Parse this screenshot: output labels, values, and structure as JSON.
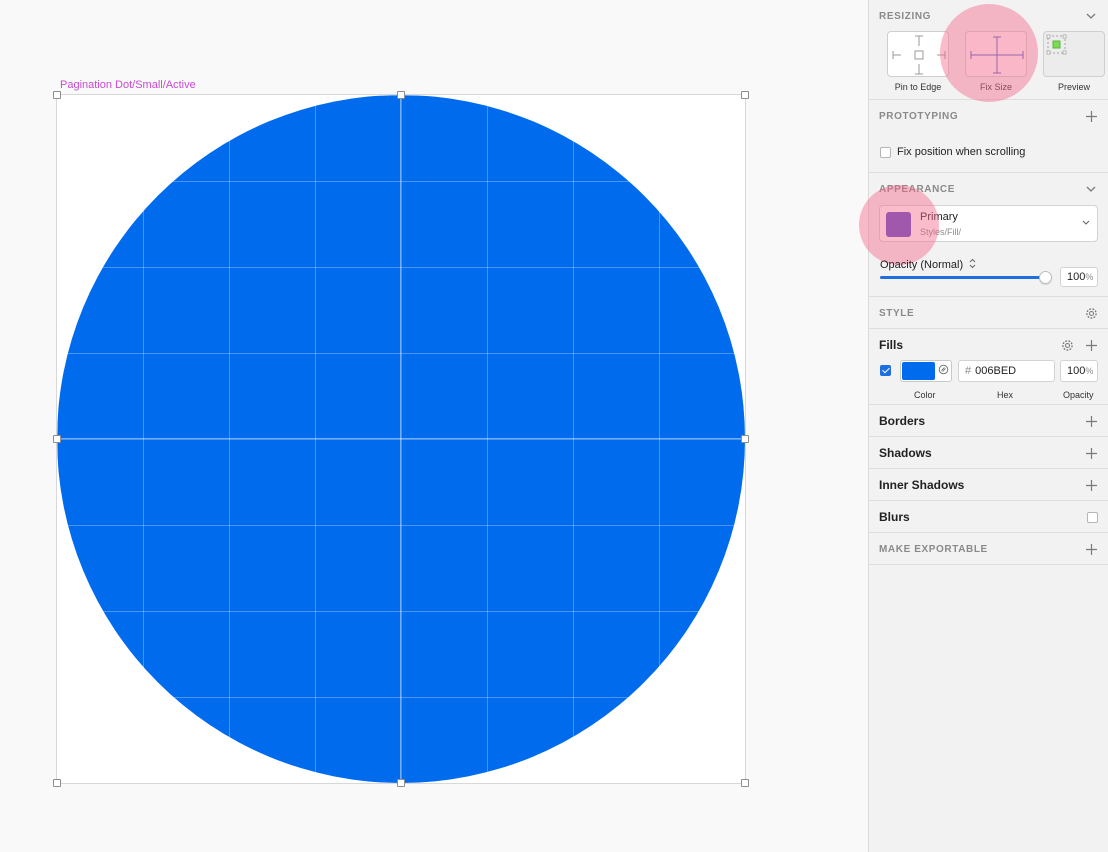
{
  "canvas": {
    "artboard_label": "Pagination Dot/Small/Active",
    "dot_color": "#006BED"
  },
  "inspector": {
    "resizing": {
      "title": "RESIZING",
      "options": [
        {
          "label": "Pin to Edge"
        },
        {
          "label": "Fix Size"
        },
        {
          "label": "Preview"
        }
      ]
    },
    "prototyping": {
      "title": "PROTOTYPING",
      "fix_position_label": "Fix position when scrolling"
    },
    "appearance": {
      "title": "APPEARANCE",
      "style_name": "Primary",
      "style_path": "Styles/Fill/",
      "swatch_color": "#5a4bc5",
      "opacity_label": "Opacity (Normal)",
      "opacity_value": "100",
      "opacity_unit": "%",
      "opacity_fraction": 1.0
    },
    "style": {
      "title": "STYLE"
    },
    "fills": {
      "title": "Fills",
      "enabled": true,
      "hex_prefix": "#",
      "hex": "006BED",
      "opacity_value": "100",
      "opacity_unit": "%",
      "captions": {
        "color": "Color",
        "hex": "Hex",
        "opacity": "Opacity"
      }
    },
    "borders": {
      "title": "Borders"
    },
    "shadows": {
      "title": "Shadows"
    },
    "inner_shadows": {
      "title": "Inner Shadows"
    },
    "blurs": {
      "title": "Blurs"
    },
    "make_exportable": {
      "title": "MAKE EXPORTABLE"
    }
  }
}
